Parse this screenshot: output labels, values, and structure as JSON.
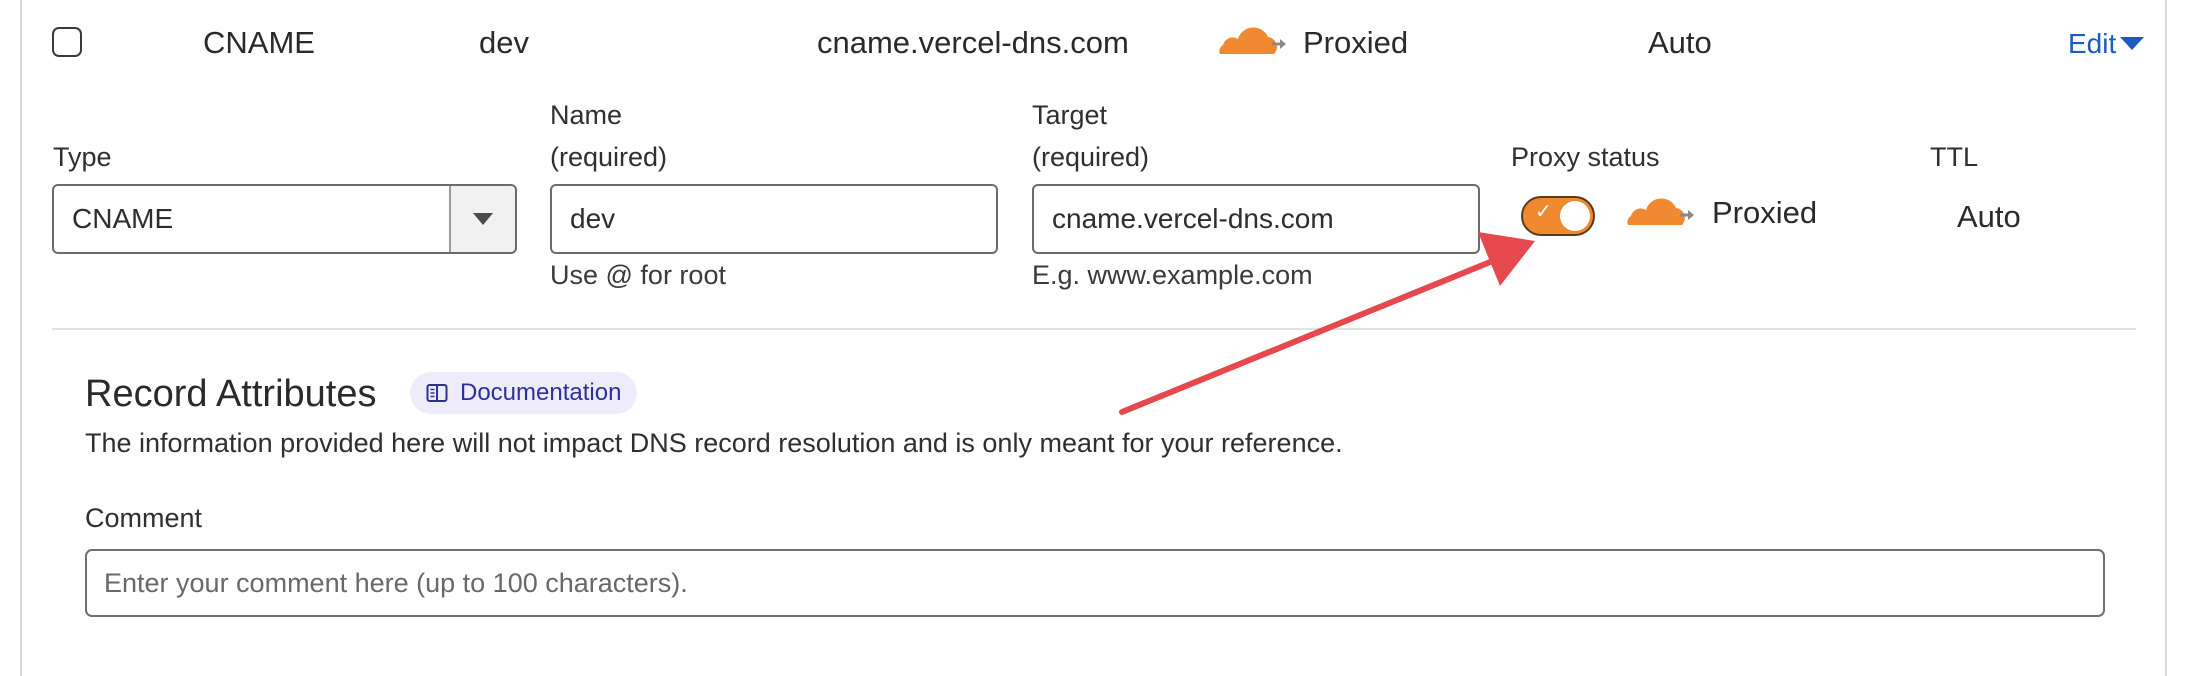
{
  "record_row": {
    "type": "CNAME",
    "name": "dev",
    "content": "cname.vercel-dns.com",
    "proxy_status": "Proxied",
    "ttl": "Auto",
    "edit_label": "Edit"
  },
  "form": {
    "type_label": "Type",
    "type_value": "CNAME",
    "name_label_line1": "Name",
    "name_label_line2": "(required)",
    "name_value": "dev",
    "name_help": "Use @ for root",
    "target_label_line1": "Target",
    "target_label_line2": "(required)",
    "target_value": "cname.vercel-dns.com",
    "target_help": "E.g. www.example.com",
    "proxy_label": "Proxy status",
    "proxy_value": "Proxied",
    "proxy_enabled": true,
    "ttl_label": "TTL",
    "ttl_value": "Auto"
  },
  "attributes": {
    "title": "Record Attributes",
    "doc_badge": "Documentation",
    "description": "The information provided here will not impact DNS record resolution and is only meant for your reference.",
    "comment_label": "Comment",
    "comment_placeholder": "Enter your comment here (up to 100 characters)."
  },
  "colors": {
    "accent_orange": "#f0892f",
    "link_blue": "#1a5cbf",
    "annotation_red": "#e5484d",
    "badge_bg": "#eeecfb"
  },
  "icons": {
    "cloud": "cloudflare-cloud-icon",
    "doc": "book-icon",
    "caret": "caret-down-icon"
  }
}
